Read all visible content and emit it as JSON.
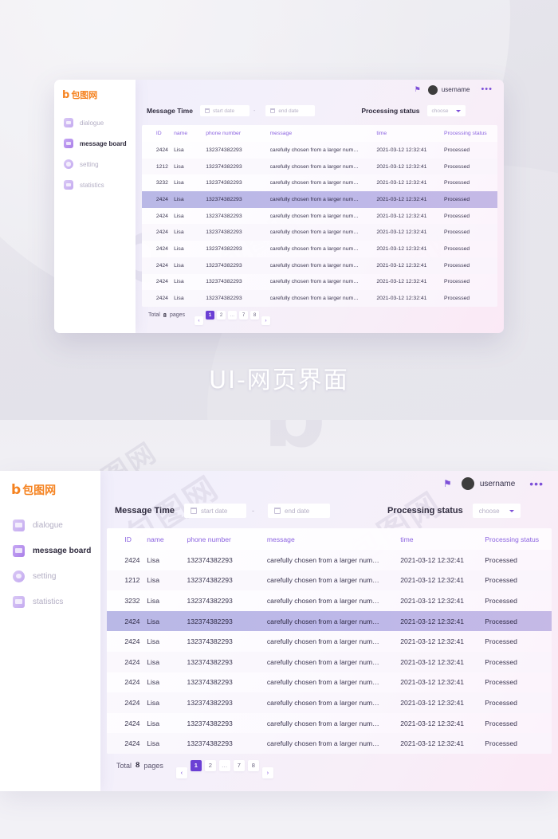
{
  "brand": {
    "logo_mark": "b",
    "logo_text": "包图网"
  },
  "caption": "UI-网页界面",
  "watermark": {
    "text": "包图网",
    "mark": "b"
  },
  "colors": {
    "accent": "#7d50d8",
    "accent_dark": "#6b3fd4",
    "brand_orange": "#f5821f",
    "header_text": "#8b63e0",
    "selected_row": "#bdb8e8",
    "page_bg": "#e6e5ec"
  },
  "sidebar": {
    "items": [
      {
        "label": "dialogue",
        "icon": "chat-bubble-icon",
        "active": false
      },
      {
        "label": "message board",
        "icon": "message-board-icon",
        "active": true
      },
      {
        "label": "setting",
        "icon": "gear-icon",
        "active": false
      },
      {
        "label": "statistics",
        "icon": "bar-chart-icon",
        "active": false
      }
    ]
  },
  "topbar": {
    "bell_icon": "notification-bell-icon",
    "avatar_icon": "user-avatar",
    "username": "username",
    "more_icon": "more-options-icon",
    "more_glyph": "•••",
    "bell_glyph": "⚑"
  },
  "filters": {
    "message_time_label": "Message Time",
    "start_date_placeholder": "start date",
    "end_date_placeholder": "end date",
    "date_separator": "-",
    "calendar_icon": "calendar-icon",
    "processing_status_label": "Processing status",
    "status_select_value": "choose",
    "status_select_options": [
      "choose"
    ],
    "caret_icon": "chevron-down-icon"
  },
  "table": {
    "columns": [
      {
        "key": "id",
        "label": "ID"
      },
      {
        "key": "name",
        "label": "name"
      },
      {
        "key": "phone",
        "label": "phone number"
      },
      {
        "key": "message",
        "label": "message"
      },
      {
        "key": "time",
        "label": "time"
      },
      {
        "key": "status",
        "label": "Processing status"
      }
    ],
    "rows": [
      {
        "id": "2424",
        "name": "Lisa",
        "phone": "132374382293",
        "message": "carefully chosen from a larger num…",
        "time": "2021-03-12 12:32:41",
        "status": "Processed",
        "selected": false
      },
      {
        "id": "1212",
        "name": "Lisa",
        "phone": "132374382293",
        "message": "carefully chosen from a larger num…",
        "time": "2021-03-12 12:32:41",
        "status": "Processed",
        "selected": false
      },
      {
        "id": "3232",
        "name": "Lisa",
        "phone": "132374382293",
        "message": "carefully chosen from a larger num…",
        "time": "2021-03-12 12:32:41",
        "status": "Processed",
        "selected": false
      },
      {
        "id": "2424",
        "name": "Lisa",
        "phone": "132374382293",
        "message": "carefully chosen from a larger num…",
        "time": "2021-03-12 12:32:41",
        "status": "Processed",
        "selected": true
      },
      {
        "id": "2424",
        "name": "Lisa",
        "phone": "132374382293",
        "message": "carefully chosen from a larger num…",
        "time": "2021-03-12 12:32:41",
        "status": "Processed",
        "selected": false
      },
      {
        "id": "2424",
        "name": "Lisa",
        "phone": "132374382293",
        "message": "carefully chosen from a larger num…",
        "time": "2021-03-12 12:32:41",
        "status": "Processed",
        "selected": false
      },
      {
        "id": "2424",
        "name": "Lisa",
        "phone": "132374382293",
        "message": "carefully chosen from a larger num…",
        "time": "2021-03-12 12:32:41",
        "status": "Processed",
        "selected": false
      },
      {
        "id": "2424",
        "name": "Lisa",
        "phone": "132374382293",
        "message": "carefully chosen from a larger num…",
        "time": "2021-03-12 12:32:41",
        "status": "Processed",
        "selected": false
      },
      {
        "id": "2424",
        "name": "Lisa",
        "phone": "132374382293",
        "message": "carefully chosen from a larger num…",
        "time": "2021-03-12 12:32:41",
        "status": "Processed",
        "selected": false
      },
      {
        "id": "2424",
        "name": "Lisa",
        "phone": "132374382293",
        "message": "carefully chosen from a larger num…",
        "time": "2021-03-12 12:32:41",
        "status": "Processed",
        "selected": false
      }
    ]
  },
  "pagination": {
    "total_label": "Total",
    "total_value": "8",
    "pages_label": "pages",
    "buttons": [
      {
        "label": "‹",
        "type": "prev",
        "active": false
      },
      {
        "label": "1",
        "type": "page",
        "active": true
      },
      {
        "label": "2",
        "type": "page",
        "active": false
      },
      {
        "label": "…",
        "type": "ellipsis",
        "active": false
      },
      {
        "label": "7",
        "type": "page",
        "active": false
      },
      {
        "label": "8",
        "type": "page",
        "active": false
      },
      {
        "label": "›",
        "type": "next",
        "active": false
      }
    ]
  }
}
